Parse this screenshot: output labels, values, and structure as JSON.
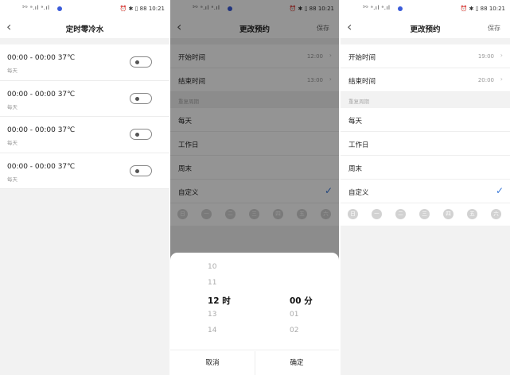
{
  "status_bar": {
    "left_signal": "⁵ᴳ ᵃ.ıl ᵃ.ıl",
    "right": "⏰ ✱ ▯ 88 10:21"
  },
  "screen1": {
    "title": "定时零冷水",
    "back_glyph": "‹",
    "items": [
      {
        "time": "00:00 - 00:00 37℃",
        "repeat": "每天",
        "enabled": false
      },
      {
        "time": "00:00 - 00:00 37℃",
        "repeat": "每天",
        "enabled": false
      },
      {
        "time": "00:00 - 00:00 37℃",
        "repeat": "每天",
        "enabled": false
      },
      {
        "time": "00:00 - 00:00 37℃",
        "repeat": "每天",
        "enabled": false
      }
    ]
  },
  "screen2": {
    "title": "更改预约",
    "save": "保存",
    "start_label": "开始时间",
    "start_value": "12:00",
    "end_label": "结束时间",
    "end_value": "13:00",
    "repeat_header": "重复周期",
    "options": [
      "每天",
      "工作日",
      "周末",
      "自定义"
    ],
    "selected_option": "自定义",
    "weekdays": [
      "日",
      "一",
      "二",
      "三",
      "四",
      "五",
      "六"
    ],
    "picker": {
      "hours": [
        "10",
        "11",
        "12 时",
        "13",
        "14"
      ],
      "minutes": [
        "",
        "",
        "00 分",
        "01",
        "02"
      ],
      "cancel": "取消",
      "confirm": "确定"
    }
  },
  "screen3": {
    "title": "更改预约",
    "save": "保存",
    "start_label": "开始时间",
    "start_value": "19:00",
    "end_label": "结束时间",
    "end_value": "20:00",
    "repeat_header": "重复周期",
    "options": [
      "每天",
      "工作日",
      "周末",
      "自定义"
    ],
    "selected_option": "自定义",
    "weekdays": [
      "日",
      "一",
      "二",
      "三",
      "四",
      "五",
      "六"
    ]
  },
  "glyphs": {
    "chevron": "›",
    "check": "✓"
  },
  "colors": {
    "accent": "#3a78d8",
    "weekday_inactive": "#d2d2d2"
  }
}
